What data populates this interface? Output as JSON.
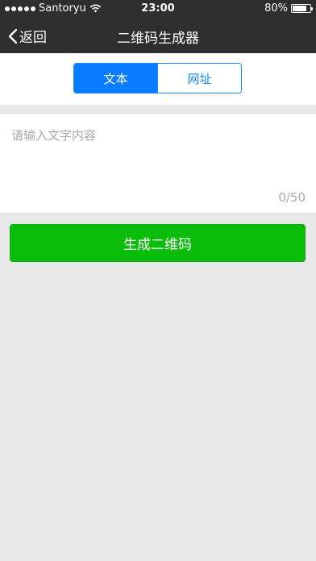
{
  "status_bar": {
    "carrier": "Santoryu",
    "time": "23:00",
    "battery": "80%",
    "battery_level": 0.8
  },
  "nav": {
    "back_label": "返回",
    "title": "二维码生成器"
  },
  "segments": {
    "text_tab": "文本",
    "url_tab": "网址",
    "selected": "文本"
  },
  "input": {
    "placeholder": "请输入文字内容",
    "value": "",
    "counter": "0/50"
  },
  "generate_button": {
    "label": "生成二维码"
  },
  "colors": {
    "nav_bg": "#2e2e2e",
    "accent_blue": "#0a7cff",
    "button_green": "#0bbd0b",
    "page_bg": "#e8e8e8"
  },
  "icons": [
    "signal-dots-icon",
    "wifi-icon",
    "battery-icon",
    "chevron-left-icon"
  ]
}
